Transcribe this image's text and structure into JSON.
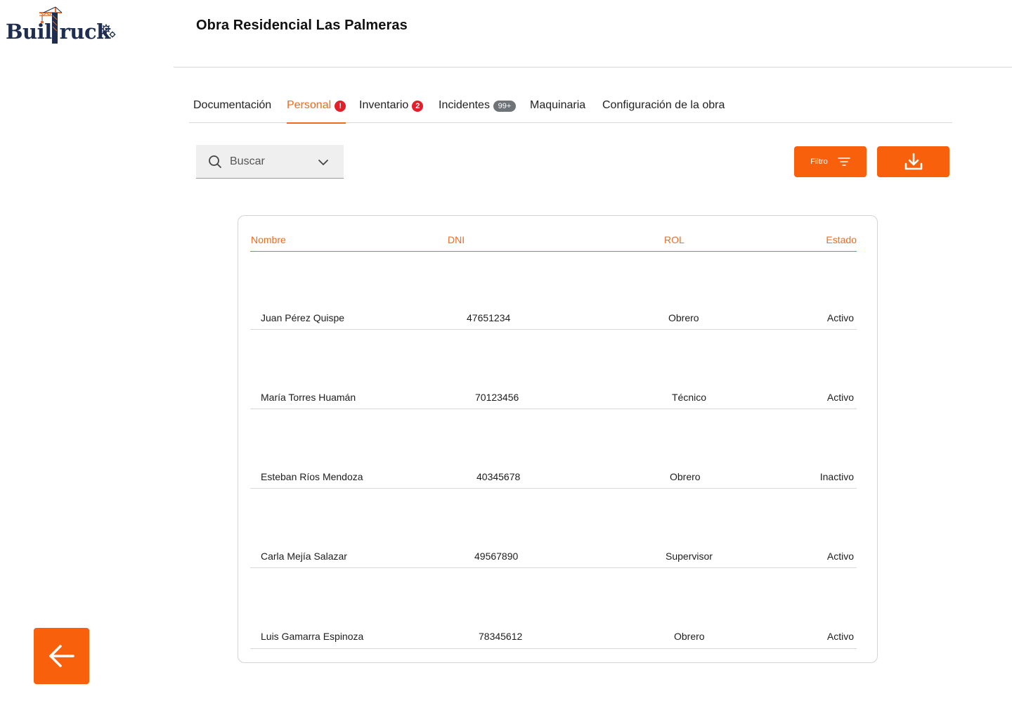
{
  "logo": {
    "text_before": "Buil",
    "text_after": "ruck",
    "colors": {
      "navy": "#1f2d4f",
      "orange": "#f26a1b"
    }
  },
  "header": {
    "title": "Obra Residencial Las Palmeras"
  },
  "tabs": [
    {
      "label": "Documentación",
      "active": false,
      "badge": null
    },
    {
      "label": "Personal",
      "active": true,
      "badge": "!"
    },
    {
      "label": "Inventario",
      "active": false,
      "badge": "2"
    },
    {
      "label": "Incidentes",
      "active": false,
      "badge": "99+"
    },
    {
      "label": "Maquinaria",
      "active": false,
      "badge": null
    },
    {
      "label": "Configuración de la obra",
      "active": false,
      "badge": null
    }
  ],
  "search": {
    "placeholder": "Buscar",
    "value": ""
  },
  "toolbar": {
    "filter_label": "Filtro",
    "download_icon": "download-icon"
  },
  "table": {
    "columns": [
      "Nombre",
      "DNI",
      "ROL",
      "Estado"
    ],
    "rows": [
      {
        "nombre": "Juan Pérez Quispe",
        "dni": "47651234",
        "rol": "Obrero",
        "estado": "Activo"
      },
      {
        "nombre": "María Torres Huamán",
        "dni": "70123456",
        "rol": "Técnico",
        "estado": "Activo"
      },
      {
        "nombre": "Esteban Ríos Mendoza",
        "dni": "40345678",
        "rol": "Obrero",
        "estado": "Inactivo"
      },
      {
        "nombre": "Carla Mejía Salazar",
        "dni": "49567890",
        "rol": "Supervisor",
        "estado": "Activo"
      },
      {
        "nombre": "Luis Gamarra Espinoza",
        "dni": "78345612",
        "rol": "Obrero",
        "estado": "Activo"
      }
    ]
  },
  "navigation": {
    "back_icon": "arrow-left-icon"
  },
  "colors": {
    "accent": "#f8600b",
    "badge_red": "#e2202a",
    "badge_gray": "#6f7479"
  }
}
